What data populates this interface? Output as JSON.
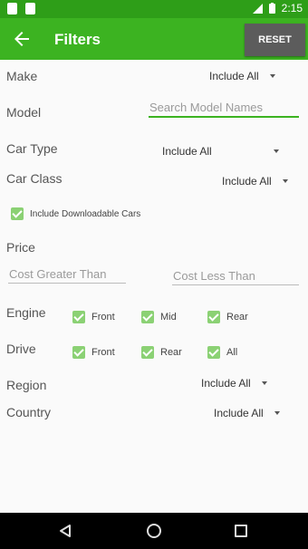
{
  "status_bar": {
    "time": "2:15"
  },
  "header": {
    "title": "Filters",
    "reset_label": "RESET"
  },
  "make": {
    "label": "Make",
    "value": "Include All"
  },
  "model": {
    "label": "Model",
    "placeholder": "Search Model Names"
  },
  "car_type": {
    "label": "Car Type",
    "value": "Include All"
  },
  "car_class": {
    "label": "Car Class",
    "value": "Include All"
  },
  "downloadable": {
    "label": "Include Downloadable Cars",
    "checked": true
  },
  "price": {
    "label": "Price",
    "min_placeholder": "Cost Greater Than",
    "max_placeholder": "Cost Less Than"
  },
  "engine": {
    "label": "Engine",
    "options": [
      "Front",
      "Mid",
      "Rear"
    ]
  },
  "drive": {
    "label": "Drive",
    "options": [
      "Front",
      "Rear",
      "All"
    ]
  },
  "region": {
    "label": "Region",
    "value": "Include All"
  },
  "country": {
    "label": "Country",
    "value": "Include All"
  },
  "colors": {
    "status_bar": "#2e9e18",
    "app_bar": "#3cb321",
    "checkbox": "#8bd174",
    "reset_button": "#5c5c5c"
  }
}
